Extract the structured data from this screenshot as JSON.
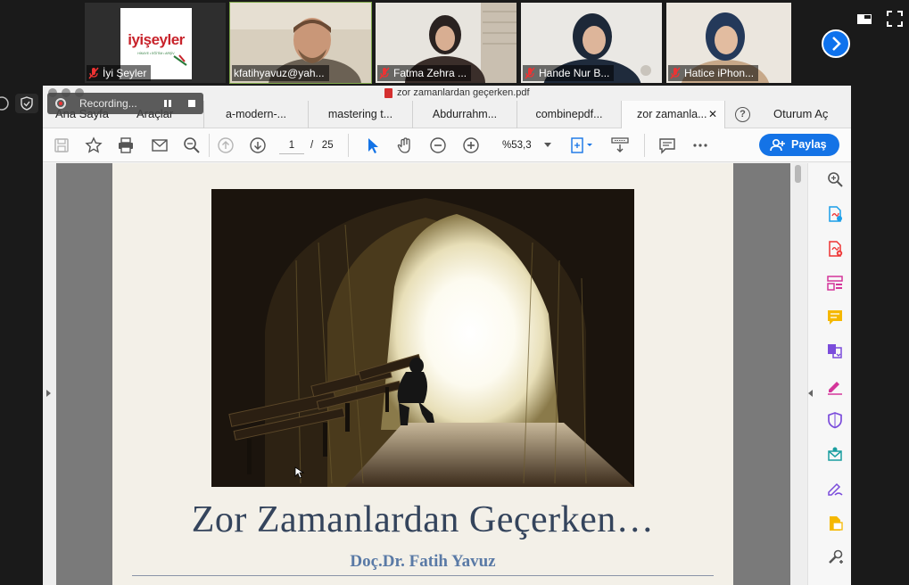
{
  "video_strip": {
    "participants": [
      {
        "name": "İyi Şeyler",
        "muted": true,
        "logo_text": "iyişeyler",
        "logo_subtext": "HİKAYE • EĞİTİM • ARŞİV"
      },
      {
        "name": "kfatihyavuz@yah...",
        "muted": false,
        "active": true
      },
      {
        "name": "Fatma Zehra ...",
        "muted": true
      },
      {
        "name": "Hande Nur B...",
        "muted": true
      },
      {
        "name": "Hatice iPhon...",
        "muted": true
      }
    ],
    "next_icon": "chevron-right-icon",
    "layout_icon": "gallery-view-icon",
    "fullscreen_icon": "fullscreen-icon"
  },
  "recording": {
    "label": "Recording...",
    "pause_icon": "pause-icon",
    "stop_icon": "stop-icon"
  },
  "window": {
    "title": "zor zamanlardan geçerken.pdf",
    "menu": {
      "home": "Ana Sayfa",
      "tools": "Araçlar"
    },
    "tabs": [
      "a-modern-...",
      "mastering t...",
      "Abdurrahm...",
      "combinepdf...",
      "zor zamanla..."
    ],
    "active_tab_index": 4,
    "sign_in": "Oturum Aç",
    "toolbar": {
      "page_current": "1",
      "page_separator": "/",
      "page_total": "25",
      "zoom": "%53,3",
      "share": "Paylaş"
    }
  },
  "document": {
    "title": "Zor Zamanlardan Geçerken…",
    "author": "Doç.Dr. Fatih Yavuz"
  },
  "colors": {
    "accent": "#1473e6",
    "zoom_blue": "#0e72ed",
    "doc_title": "#34445c",
    "doc_author": "#5a7aa6"
  }
}
